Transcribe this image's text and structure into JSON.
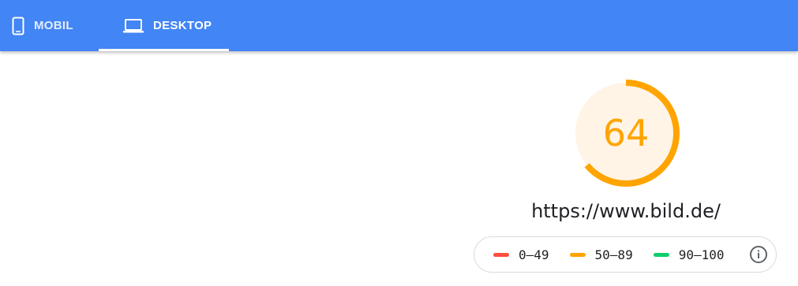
{
  "tabs": [
    {
      "label": "MOBIL",
      "icon": "smartphone-icon",
      "active": false
    },
    {
      "label": "DESKTOP",
      "icon": "laptop-icon",
      "active": true
    }
  ],
  "report": {
    "score": "64",
    "score_fraction": 0.64,
    "url": "https://www.bild.de/"
  },
  "legend": {
    "items": [
      {
        "label": "0–49",
        "color": "#ff4e42"
      },
      {
        "label": "50–89",
        "color": "#ffa400"
      },
      {
        "label": "90–100",
        "color": "#0cce6b"
      }
    ],
    "info_icon": "info-icon"
  },
  "colors": {
    "header": "#4285f4",
    "score_fill": "#fff4e5",
    "score_stroke": "#ffa400"
  }
}
